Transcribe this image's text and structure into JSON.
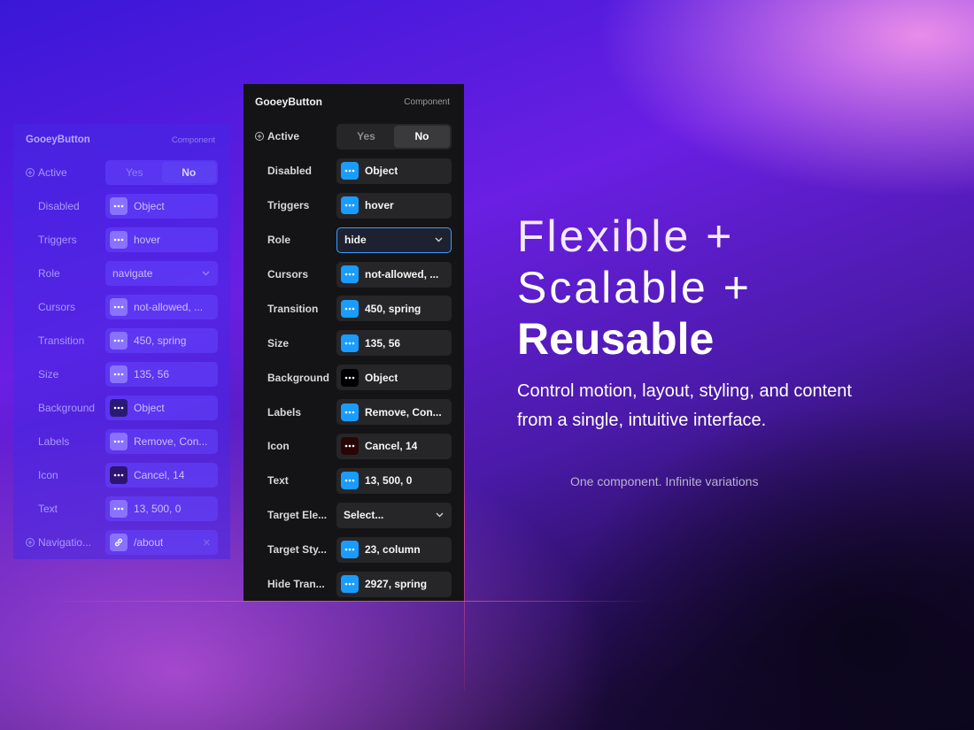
{
  "front_panel": {
    "title": "GooeyButton",
    "badge": "Component",
    "active": {
      "label": "Active",
      "yes": "Yes",
      "no": "No",
      "selected": "No"
    },
    "rows": [
      {
        "label": "Disabled",
        "value": "Object",
        "chip": "blue"
      },
      {
        "label": "Triggers",
        "value": "hover",
        "chip": "blue"
      },
      {
        "label": "Role",
        "value": "hide",
        "type": "select"
      },
      {
        "label": "Cursors",
        "value": "not-allowed, ...",
        "chip": "blue"
      },
      {
        "label": "Transition",
        "value": "450, spring",
        "chip": "blue"
      },
      {
        "label": "Size",
        "value": "135, 56",
        "chip": "blue"
      },
      {
        "label": "Background",
        "value": "Object",
        "chip": "black"
      },
      {
        "label": "Labels",
        "value": "Remove, Con...",
        "chip": "blue"
      },
      {
        "label": "Icon",
        "value": "Cancel, 14",
        "chip": "dark-red"
      },
      {
        "label": "Text",
        "value": "13, 500, 0",
        "chip": "blue"
      },
      {
        "label": "Target Ele...",
        "value": "Select...",
        "type": "select"
      },
      {
        "label": "Target Sty...",
        "value": "23, column",
        "chip": "blue"
      },
      {
        "label": "Hide Tran...",
        "value": "2927, spring",
        "chip": "blue"
      }
    ]
  },
  "back_panel": {
    "title": "GooeyButton",
    "badge": "Component",
    "active": {
      "label": "Active",
      "yes": "Yes",
      "no": "No",
      "selected": "No"
    },
    "rows": [
      {
        "label": "Disabled",
        "value": "Object",
        "chip": "blue"
      },
      {
        "label": "Triggers",
        "value": "hover",
        "chip": "blue"
      },
      {
        "label": "Role",
        "value": "navigate",
        "type": "select"
      },
      {
        "label": "Cursors",
        "value": "not-allowed, ...",
        "chip": "blue"
      },
      {
        "label": "Transition",
        "value": "450, spring",
        "chip": "blue"
      },
      {
        "label": "Size",
        "value": "135, 56",
        "chip": "blue"
      },
      {
        "label": "Background",
        "value": "Object",
        "chip": "black"
      },
      {
        "label": "Labels",
        "value": "Remove, Con...",
        "chip": "blue"
      },
      {
        "label": "Icon",
        "value": "Cancel, 14",
        "chip": "dark-red"
      },
      {
        "label": "Text",
        "value": "13, 500, 0",
        "chip": "blue"
      }
    ],
    "navigation": {
      "label": "Navigatio...",
      "value": "/about",
      "icon": "link-icon"
    }
  },
  "hero": {
    "line1": "Flexible +",
    "line2": "Scalable +",
    "line3": "Reusable",
    "subtitle": "Control motion, layout, styling, and content from a single, intuitive interface.",
    "tagline": "One component. Infinite variations"
  },
  "colors": {
    "accent_blue": "#1a9cff",
    "panel_bg": "#141416",
    "focus_border": "#3a9dff"
  }
}
